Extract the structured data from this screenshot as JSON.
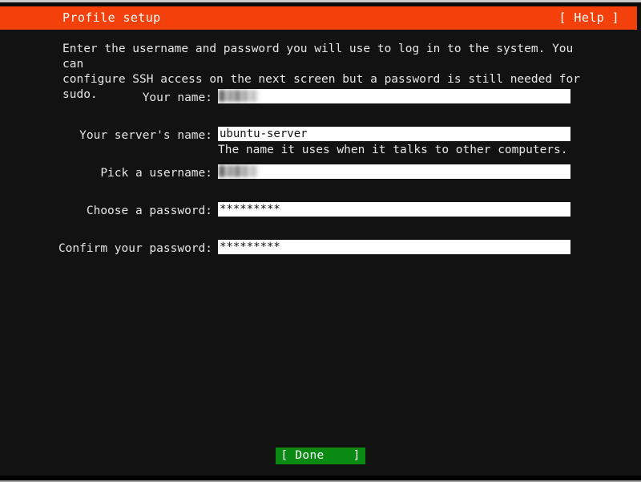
{
  "header": {
    "title": "Profile setup",
    "help_label": "[ Help ]",
    "bar_color": "#f4410b"
  },
  "intro": {
    "text": "Enter the username and password you will use to log in to the system. You can\nconfigure SSH access on the next screen but a password is still needed for\nsudo."
  },
  "form": {
    "rows": [
      {
        "label": "Your name:",
        "value": "████",
        "redacted": true,
        "helper": ""
      },
      {
        "label": "Your server's name:",
        "value": "ubuntu-server",
        "redacted": false,
        "helper": "The name it uses when it talks to other computers."
      },
      {
        "label": "Pick a username:",
        "value": "████",
        "redacted": true,
        "helper": ""
      },
      {
        "label": "Choose a password:",
        "value": "*********",
        "redacted": false,
        "helper": ""
      },
      {
        "label": "Confirm your password:",
        "value": "*********",
        "redacted": false,
        "helper": ""
      }
    ]
  },
  "footer": {
    "done_label": "[ Done    ]",
    "done_color": "#0a8a12"
  },
  "colors": {
    "background": "#121212",
    "text": "#e6e6e6",
    "field_background": "#ffffff"
  }
}
